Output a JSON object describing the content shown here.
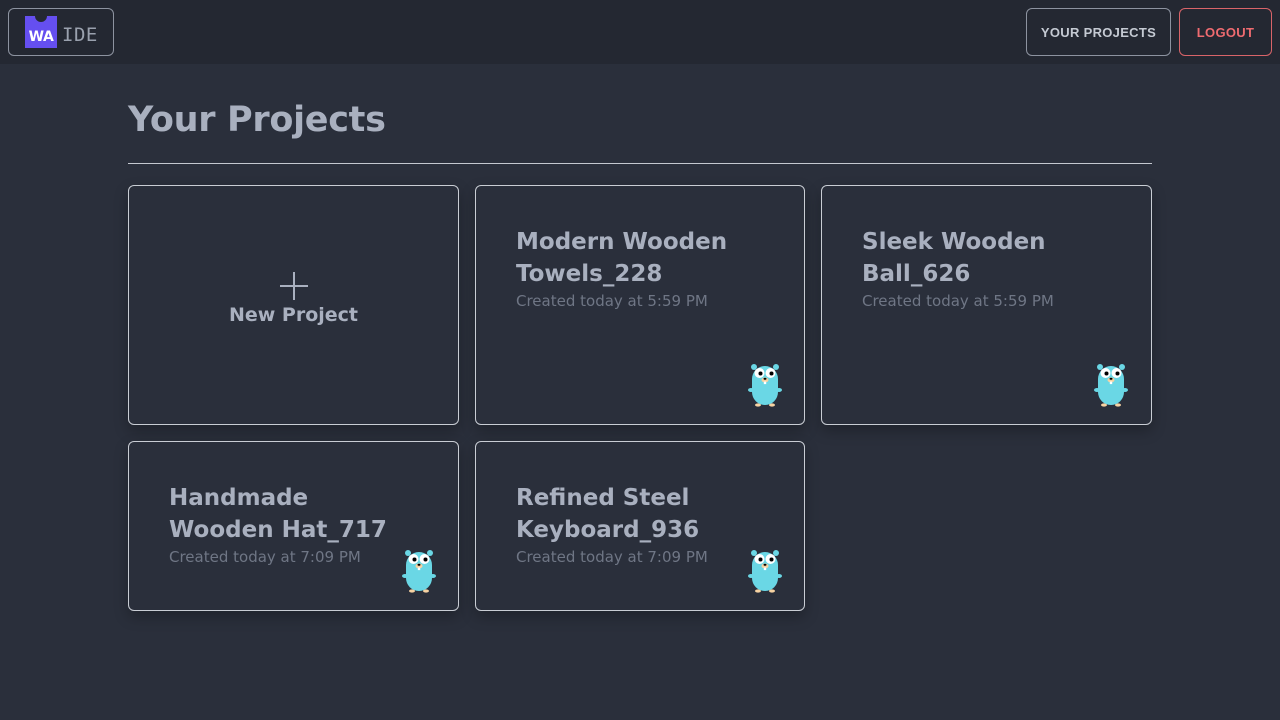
{
  "header": {
    "logo_mark": "WA",
    "logo_text": "IDE",
    "nav": {
      "projects_label": "YOUR PROJECTS",
      "logout_label": "LOGOUT"
    }
  },
  "main": {
    "title": "Your Projects",
    "new_project_label": "New Project",
    "projects": [
      {
        "name": "Modern Wooden Towels_228",
        "created": "Created today at 5:59 PM",
        "icon": "gopher-icon"
      },
      {
        "name": "Sleek Wooden Ball_626",
        "created": "Created today at 5:59 PM",
        "icon": "gopher-icon"
      },
      {
        "name": "Handmade Wooden Hat_717",
        "created": "Created today at 7:09 PM",
        "icon": "gopher-icon"
      },
      {
        "name": "Refined Steel Keyboard_936",
        "created": "Created today at 7:09 PM",
        "icon": "gopher-icon"
      }
    ]
  },
  "colors": {
    "background": "#2a2f3b",
    "header_bg": "#242832",
    "accent_logo": "#654ff0",
    "logout": "#ef6b70",
    "gopher": "#6ad7e5"
  }
}
